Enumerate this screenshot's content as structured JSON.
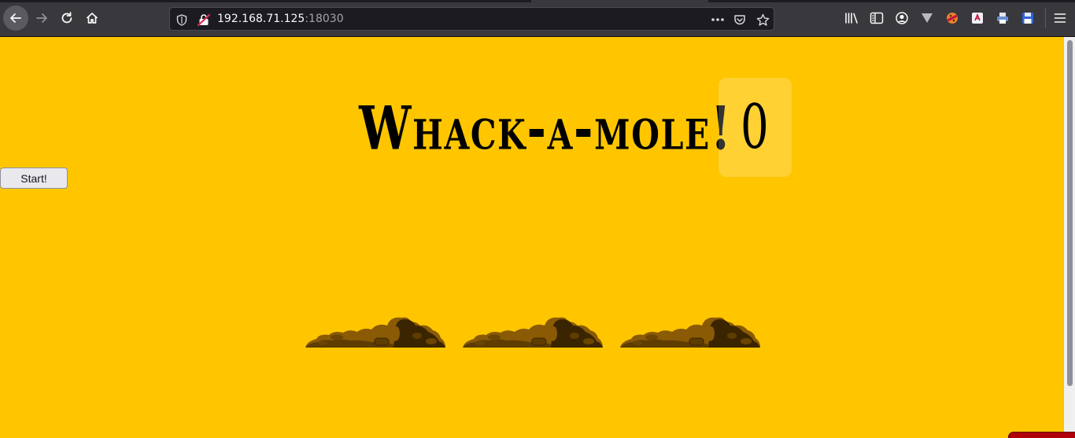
{
  "browser": {
    "url_host": "192.168.71.125",
    "url_port": ":18030"
  },
  "game": {
    "title": "Whack-a-mole!",
    "score": "0",
    "start_label": "Start!",
    "holes": 3
  },
  "colors": {
    "page_background": "#ffc600",
    "dirt_light": "#8a5a05",
    "dirt_dark": "#3b2500"
  }
}
